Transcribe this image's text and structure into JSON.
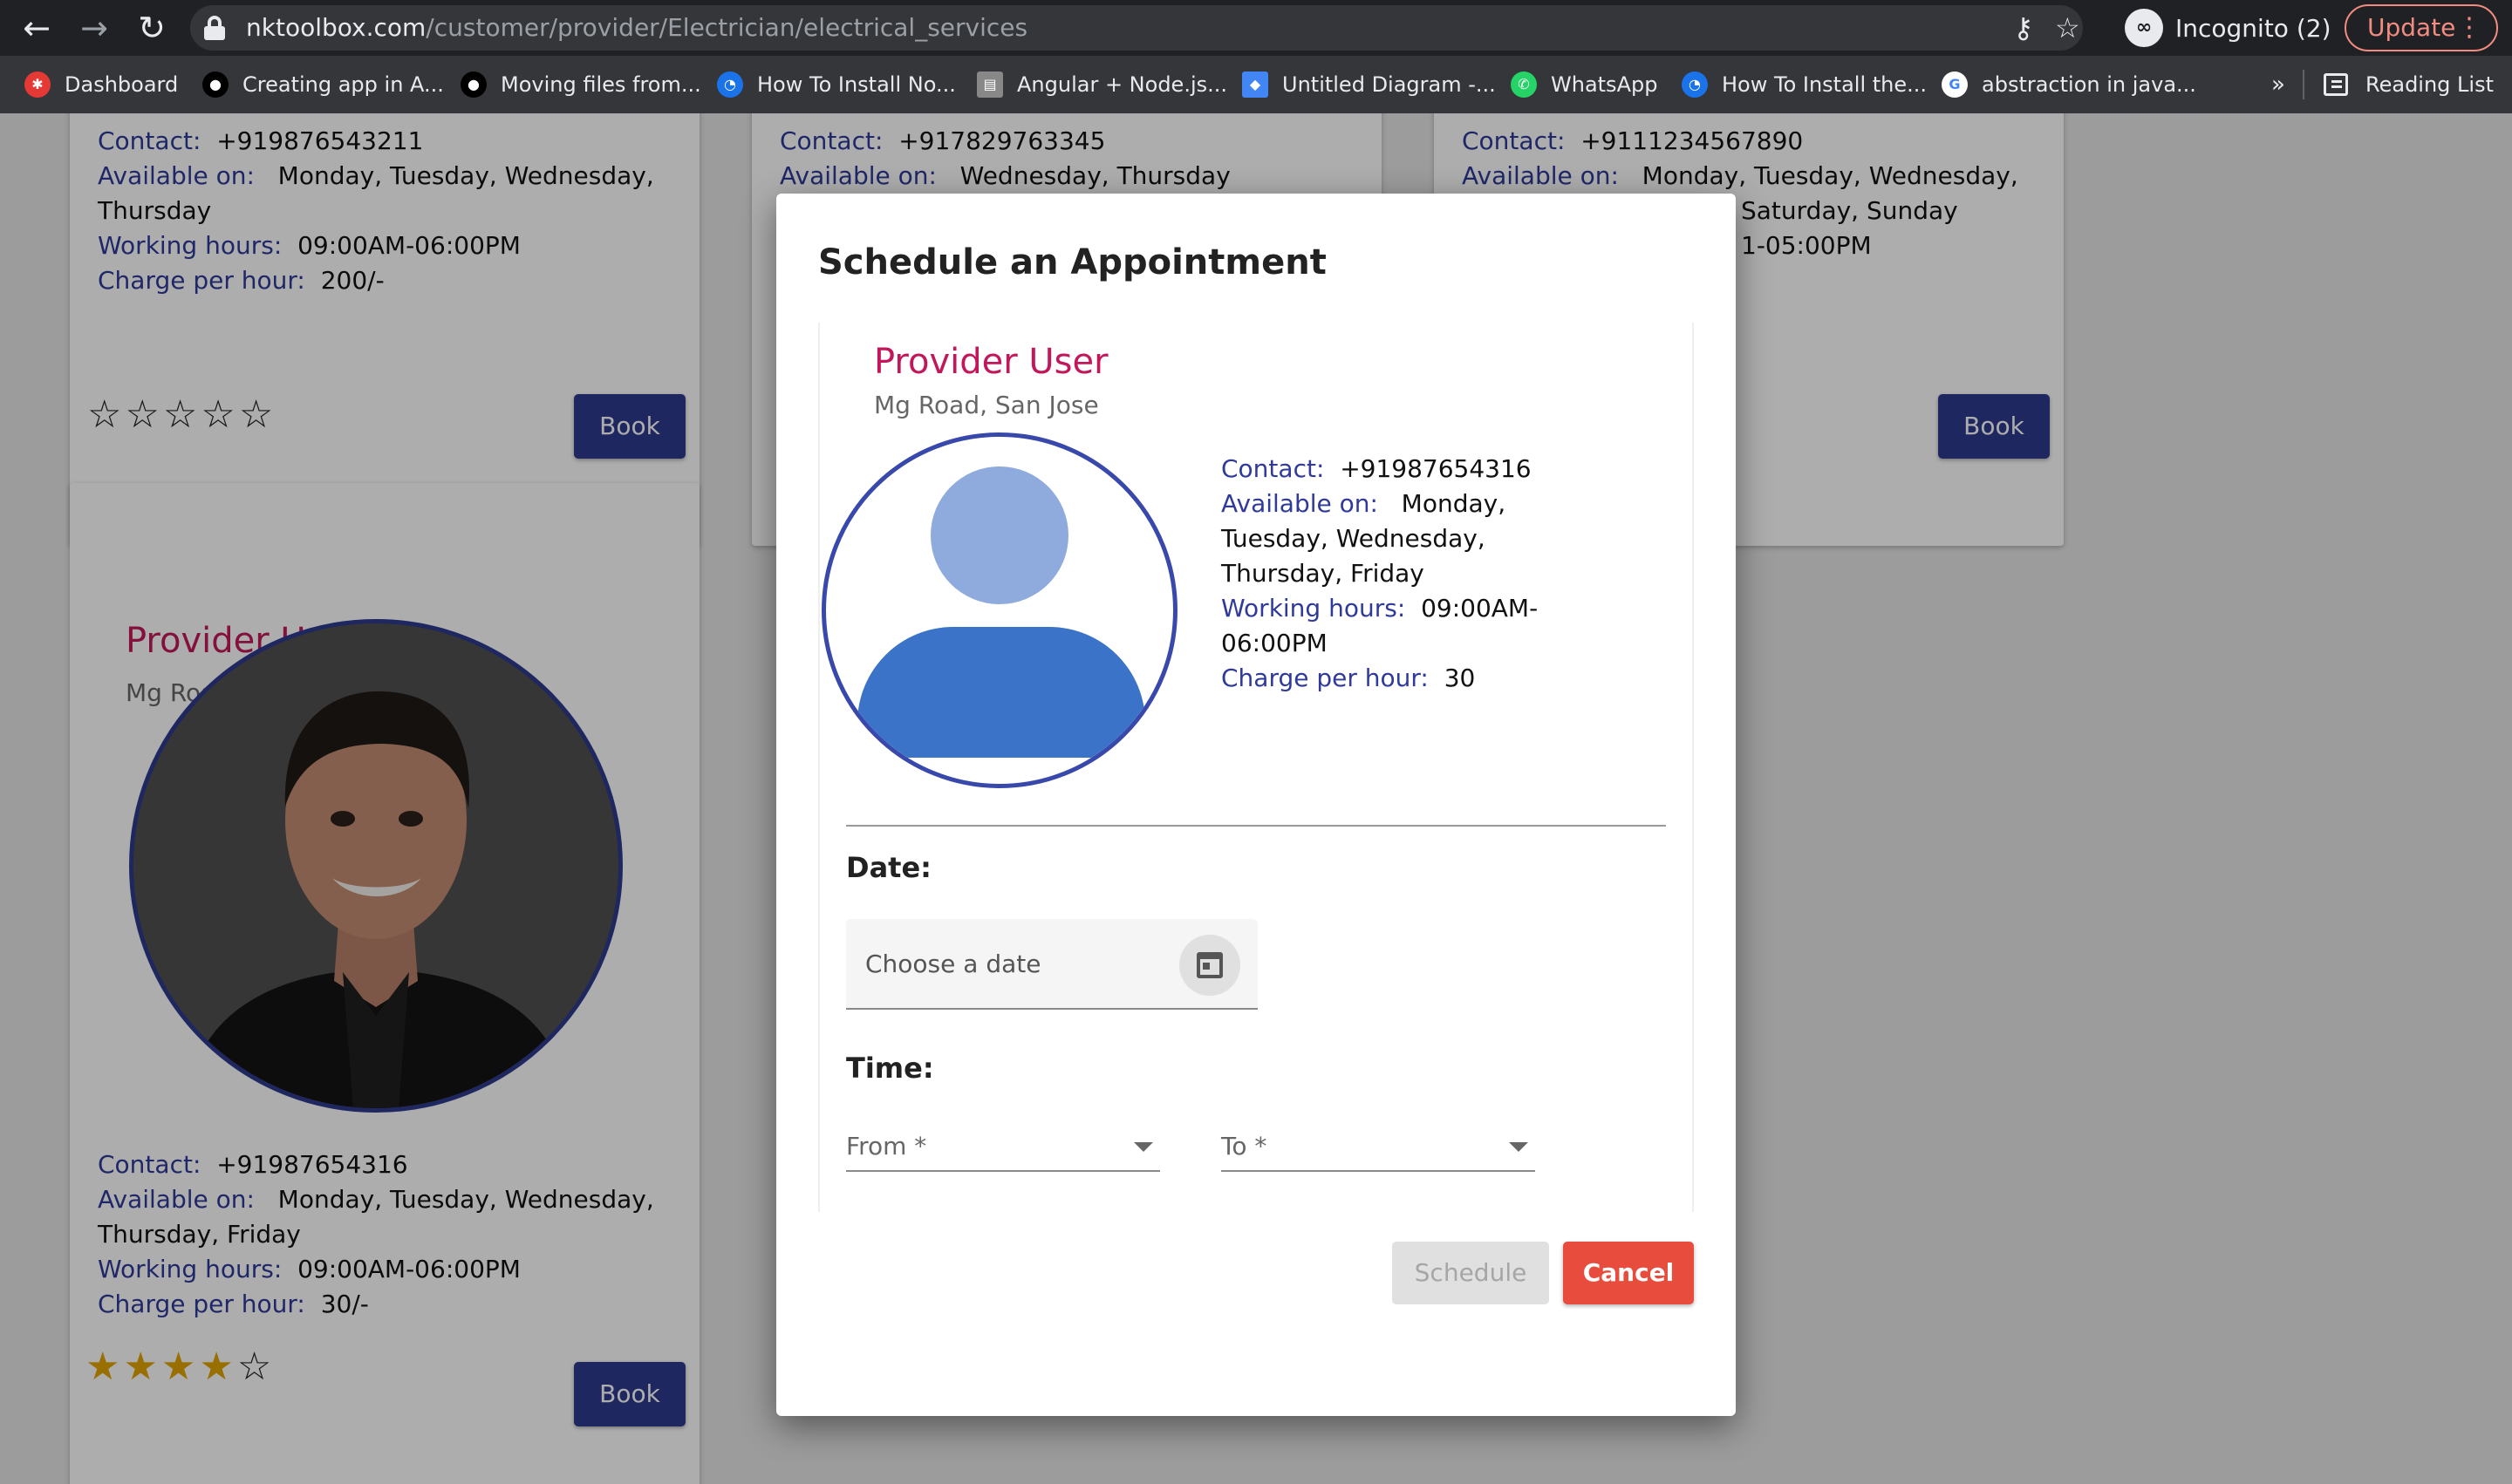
{
  "browser": {
    "url_host": "nktoolbox.com",
    "url_path": "/customer/provider/Electrician/electrical_services",
    "incognito_label": "Incognito (2)",
    "update_label": "Update",
    "bookmarks": [
      {
        "label": "Dashboard",
        "icon": "dashboard-favicon",
        "color": "#e53935"
      },
      {
        "label": "Creating app in A...",
        "icon": "medium-favicon",
        "color": "#000000"
      },
      {
        "label": "Moving files from...",
        "icon": "medium-favicon",
        "color": "#000000"
      },
      {
        "label": "How To Install No...",
        "icon": "digitalocean-favicon",
        "color": "#1a73e8"
      },
      {
        "label": "Angular + Node.js...",
        "icon": "article-favicon",
        "color": "#888888"
      },
      {
        "label": "Untitled Diagram -...",
        "icon": "drawio-favicon",
        "color": "#4285f4"
      },
      {
        "label": "WhatsApp",
        "icon": "whatsapp-favicon",
        "color": "#25d366"
      },
      {
        "label": "How To Install the...",
        "icon": "digitalocean-favicon",
        "color": "#1a73e8"
      },
      {
        "label": "abstraction in java...",
        "icon": "google-favicon",
        "color": "#ffffff"
      }
    ],
    "more_label": "»",
    "reading_list_label": "Reading List"
  },
  "labels": {
    "contact": "Contact:",
    "available": "Available on:",
    "hours": "Working hours:",
    "charge": "Charge per hour:",
    "book": "Book"
  },
  "cards": [
    {
      "contact": "+919876543211",
      "available": "Monday, Tuesday, Wednesday,",
      "available2": "Thursday",
      "hours": "09:00AM-06:00PM",
      "charge": "200/-",
      "rating": 0
    },
    {
      "contact": "+917829763345",
      "available": "Wednesday, Thursday"
    },
    {
      "contact": "+9111234567890",
      "available": "Monday, Tuesday, Wednesday,",
      "available2": "Saturday, Sunday",
      "hours": "1-05:00PM"
    },
    {
      "name": "Provider  User",
      "address": "Mg Road, San Jose",
      "contact": "+91987654316",
      "available": "Monday, Tuesday, Wednesday,",
      "available2": "Thursday, Friday",
      "hours": "09:00AM-06:00PM",
      "charge": "30/-",
      "rating": 4
    }
  ],
  "dialog": {
    "title": "Schedule an Appointment",
    "provider_name": "Provider  User",
    "provider_address": "Mg Road, San Jose",
    "contact": "+91987654316",
    "available_lines": [
      "Monday,",
      "Tuesday, Wednesday,",
      "Thursday, Friday"
    ],
    "hours_lines": [
      "09:00AM-",
      "06:00PM"
    ],
    "charge": "30",
    "date_label": "Date:",
    "date_placeholder": "Choose a date",
    "time_label": "Time:",
    "from_placeholder": "From *",
    "to_placeholder": "To *",
    "schedule_label": "Schedule",
    "cancel_label": "Cancel"
  },
  "colors": {
    "accent": "#2f3a8f",
    "name": "#c2185b",
    "cancel": "#e74c3c",
    "star": "#e0a400"
  }
}
